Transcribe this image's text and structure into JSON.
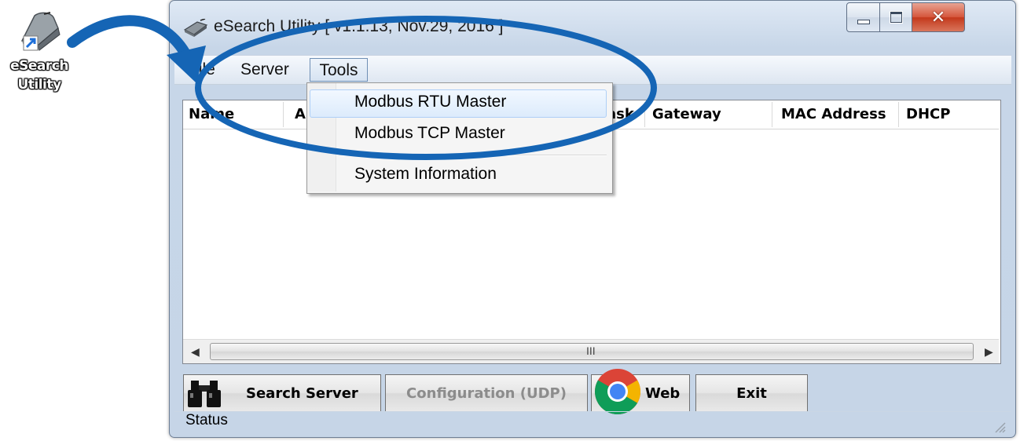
{
  "desktop": {
    "shortcut_label_line1": "eSearch",
    "shortcut_label_line2": "Utility"
  },
  "window": {
    "title": "eSearch Utility [ v1.1.13, Nov.29, 2016 ]"
  },
  "menubar": {
    "items": [
      "File",
      "Server",
      "Tools"
    ]
  },
  "tools_menu": {
    "items": [
      "Modbus RTU Master",
      "Modbus TCP Master",
      "System Information"
    ],
    "highlighted": "Modbus RTU Master"
  },
  "table": {
    "columns": [
      "Name",
      "A",
      "ask",
      "Gateway",
      "MAC Address",
      "DHCP"
    ]
  },
  "scrollbar": {
    "grip": "III"
  },
  "buttons": {
    "search": "Search Server",
    "config": "Configuration (UDP)",
    "web": "Web",
    "exit": "Exit"
  },
  "status": {
    "label": "Status"
  },
  "colors": {
    "annotation_blue": "#1565b5",
    "menu_highlight": "#dcebfc"
  }
}
